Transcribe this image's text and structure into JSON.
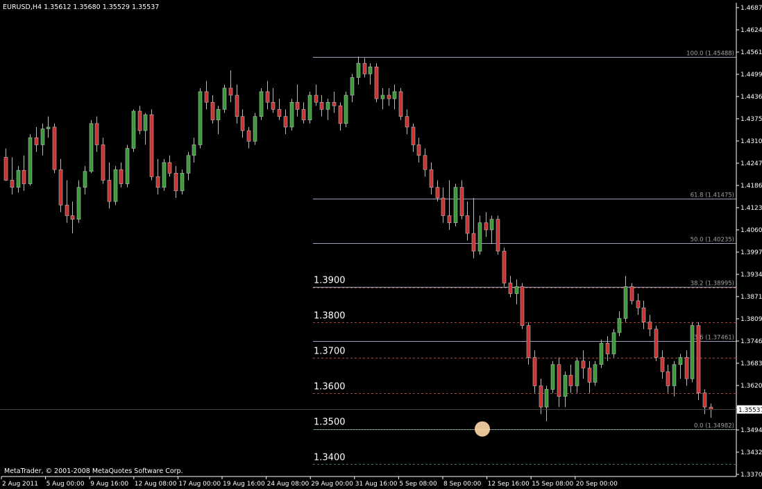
{
  "header": {
    "symbol_line": "EURUSD,H4  1.35612 1.35680 1.35529 1.35537"
  },
  "footer": {
    "copyright": "MetaTrader, © 2001-2008 MetaQuotes Software Corp."
  },
  "colors": {
    "background": "#000000",
    "axis": "#ffffff",
    "bull": "#3a9a3a",
    "bear": "#c83232",
    "wick": "#bbbbbb",
    "fib_line": "#9aa0b8",
    "round_line": "#c83232",
    "zero_line": "#4a8a4a",
    "bottom_line": "#3a7a3a",
    "circle_fill": "#ffd7a8",
    "price_tag": "#ffffff"
  },
  "chart_data": {
    "type": "candlestick",
    "symbol": "EURUSD",
    "timeframe": "H4",
    "last_price": 1.35537,
    "last_price_label": "1.35537",
    "ylim": [
      1.337,
      1.4687
    ],
    "y_ticks": [
      "1.46870",
      "1.46240",
      "1.45610",
      "1.44990",
      "1.44365",
      "1.43750",
      "1.43105",
      "1.42475",
      "1.41860",
      "1.41230",
      "1.40600",
      "1.39970",
      "1.39340",
      "1.38710",
      "1.38095",
      "1.37465",
      "1.36835",
      "1.36205",
      "1.35585",
      "1.34945",
      "1.34320",
      "1.33700"
    ],
    "x_ticks": [
      "2 Aug 2011",
      "5 Aug 00:00",
      "9 Aug 16:00",
      "12 Aug 08:00",
      "17 Aug 00:00",
      "19 Aug 16:00",
      "24 Aug 08:00",
      "29 Aug 00:00",
      "31 Aug 16:00",
      "5 Sep 08:00",
      "8 Sep 00:00",
      "12 Sep 16:00",
      "15 Sep 08:00",
      "20 Sep 00:00"
    ],
    "fibonacci": {
      "levels": [
        {
          "label": "100.0 (1.45488)",
          "price": 1.45488
        },
        {
          "label": "61.8 (1.41475)",
          "price": 1.41475
        },
        {
          "label": "50.0 (1.40235)",
          "price": 1.40235
        },
        {
          "label": "38.2 (1.38995)",
          "price": 1.38995
        },
        {
          "label": "23.6 (1.37461)",
          "price": 1.37461
        },
        {
          "label": "0.0 (1.34982)",
          "price": 1.34982
        }
      ]
    },
    "round_levels": [
      {
        "label": "1.3900",
        "price": 1.39
      },
      {
        "label": "1.3800",
        "price": 1.38
      },
      {
        "label": "1.3700",
        "price": 1.37
      },
      {
        "label": "1.3600",
        "price": 1.36
      },
      {
        "label": "1.3500",
        "price": 1.35
      },
      {
        "label": "1.3400",
        "price": 1.34
      }
    ],
    "candles": [
      [
        1.4265,
        1.429,
        1.4198,
        1.42
      ],
      [
        1.42,
        1.4265,
        1.416,
        1.418
      ],
      [
        1.418,
        1.424,
        1.4165,
        1.4228
      ],
      [
        1.4228,
        1.427,
        1.417,
        1.419
      ],
      [
        1.419,
        1.433,
        1.4185,
        1.432
      ],
      [
        1.432,
        1.435,
        1.428,
        1.43
      ],
      [
        1.43,
        1.436,
        1.427,
        1.4345
      ],
      [
        1.4345,
        1.438,
        1.432,
        1.435
      ],
      [
        1.435,
        1.436,
        1.422,
        1.423
      ],
      [
        1.423,
        1.426,
        1.411,
        1.413
      ],
      [
        1.413,
        1.42,
        1.408,
        1.41
      ],
      [
        1.41,
        1.414,
        1.405,
        1.409
      ],
      [
        1.409,
        1.42,
        1.408,
        1.418
      ],
      [
        1.418,
        1.424,
        1.416,
        1.4225
      ],
      [
        1.4225,
        1.437,
        1.422,
        1.436
      ],
      [
        1.436,
        1.438,
        1.428,
        1.43
      ],
      [
        1.43,
        1.432,
        1.419,
        1.42
      ],
      [
        1.42,
        1.425,
        1.412,
        1.414
      ],
      [
        1.414,
        1.424,
        1.413,
        1.423
      ],
      [
        1.423,
        1.425,
        1.418,
        1.419
      ],
      [
        1.419,
        1.43,
        1.418,
        1.429
      ],
      [
        1.429,
        1.44,
        1.428,
        1.4395
      ],
      [
        1.4395,
        1.441,
        1.433,
        1.434
      ],
      [
        1.434,
        1.439,
        1.43,
        1.4385
      ],
      [
        1.4385,
        1.44,
        1.42,
        1.421
      ],
      [
        1.421,
        1.426,
        1.416,
        1.418
      ],
      [
        1.418,
        1.426,
        1.417,
        1.425
      ],
      [
        1.425,
        1.427,
        1.421,
        1.422
      ],
      [
        1.422,
        1.424,
        1.415,
        1.417
      ],
      [
        1.417,
        1.423,
        1.416,
        1.422
      ],
      [
        1.422,
        1.428,
        1.42,
        1.427
      ],
      [
        1.427,
        1.432,
        1.425,
        1.43
      ],
      [
        1.43,
        1.446,
        1.429,
        1.445
      ],
      [
        1.445,
        1.448,
        1.44,
        1.442
      ],
      [
        1.442,
        1.444,
        1.436,
        1.437
      ],
      [
        1.437,
        1.441,
        1.433,
        1.44
      ],
      [
        1.44,
        1.447,
        1.439,
        1.446
      ],
      [
        1.446,
        1.451,
        1.442,
        1.444
      ],
      [
        1.444,
        1.447,
        1.436,
        1.438
      ],
      [
        1.438,
        1.44,
        1.432,
        1.434
      ],
      [
        1.434,
        1.435,
        1.429,
        1.431
      ],
      [
        1.431,
        1.439,
        1.43,
        1.438
      ],
      [
        1.438,
        1.446,
        1.437,
        1.445
      ],
      [
        1.445,
        1.448,
        1.44,
        1.442
      ],
      [
        1.442,
        1.446,
        1.439,
        1.44
      ],
      [
        1.44,
        1.443,
        1.437,
        1.438
      ],
      [
        1.438,
        1.44,
        1.433,
        1.435
      ],
      [
        1.435,
        1.443,
        1.434,
        1.442
      ],
      [
        1.442,
        1.447,
        1.438,
        1.44
      ],
      [
        1.44,
        1.442,
        1.436,
        1.437
      ],
      [
        1.437,
        1.445,
        1.436,
        1.444
      ],
      [
        1.444,
        1.447,
        1.441,
        1.442
      ],
      [
        1.442,
        1.444,
        1.438,
        1.44
      ],
      [
        1.44,
        1.443,
        1.437,
        1.442
      ],
      [
        1.442,
        1.445,
        1.439,
        1.441
      ],
      [
        1.441,
        1.442,
        1.434,
        1.436
      ],
      [
        1.436,
        1.445,
        1.435,
        1.444
      ],
      [
        1.444,
        1.45,
        1.442,
        1.449
      ],
      [
        1.449,
        1.4549,
        1.447,
        1.453
      ],
      [
        1.453,
        1.4545,
        1.449,
        1.45
      ],
      [
        1.45,
        1.453,
        1.447,
        1.452
      ],
      [
        1.452,
        1.453,
        1.442,
        1.443
      ],
      [
        1.443,
        1.446,
        1.44,
        1.444
      ],
      [
        1.444,
        1.446,
        1.441,
        1.443
      ],
      [
        1.443,
        1.447,
        1.44,
        1.445
      ],
      [
        1.445,
        1.446,
        1.437,
        1.438
      ],
      [
        1.438,
        1.44,
        1.433,
        1.435
      ],
      [
        1.435,
        1.436,
        1.428,
        1.43
      ],
      [
        1.43,
        1.432,
        1.425,
        1.427
      ],
      [
        1.427,
        1.429,
        1.421,
        1.423
      ],
      [
        1.423,
        1.425,
        1.416,
        1.418
      ],
      [
        1.418,
        1.42,
        1.414,
        1.415
      ],
      [
        1.415,
        1.418,
        1.408,
        1.41
      ],
      [
        1.41,
        1.42,
        1.406,
        1.408
      ],
      [
        1.408,
        1.419,
        1.407,
        1.418
      ],
      [
        1.418,
        1.42,
        1.409,
        1.41
      ],
      [
        1.41,
        1.414,
        1.403,
        1.405
      ],
      [
        1.405,
        1.415,
        1.398,
        1.4
      ],
      [
        1.4,
        1.41,
        1.399,
        1.408
      ],
      [
        1.408,
        1.411,
        1.404,
        1.406
      ],
      [
        1.406,
        1.41,
        1.402,
        1.409
      ],
      [
        1.409,
        1.41,
        1.399,
        1.4
      ],
      [
        1.4,
        1.401,
        1.39,
        1.391
      ],
      [
        1.391,
        1.393,
        1.387,
        1.388
      ],
      [
        1.388,
        1.392,
        1.385,
        1.39
      ],
      [
        1.39,
        1.391,
        1.378,
        1.379
      ],
      [
        1.379,
        1.38,
        1.368,
        1.37
      ],
      [
        1.37,
        1.372,
        1.36,
        1.362
      ],
      [
        1.362,
        1.364,
        1.354,
        1.356
      ],
      [
        1.356,
        1.362,
        1.352,
        1.361
      ],
      [
        1.361,
        1.369,
        1.36,
        1.368
      ],
      [
        1.368,
        1.37,
        1.356,
        1.359
      ],
      [
        1.359,
        1.366,
        1.356,
        1.365
      ],
      [
        1.365,
        1.368,
        1.36,
        1.362
      ],
      [
        1.362,
        1.37,
        1.36,
        1.369
      ],
      [
        1.369,
        1.372,
        1.364,
        1.367
      ],
      [
        1.367,
        1.369,
        1.36,
        1.363
      ],
      [
        1.363,
        1.369,
        1.362,
        1.368
      ],
      [
        1.368,
        1.375,
        1.367,
        1.374
      ],
      [
        1.374,
        1.376,
        1.369,
        1.371
      ],
      [
        1.371,
        1.378,
        1.37,
        1.377
      ],
      [
        1.377,
        1.383,
        1.376,
        1.381
      ],
      [
        1.381,
        1.393,
        1.38,
        1.39
      ],
      [
        1.39,
        1.391,
        1.385,
        1.386
      ],
      [
        1.386,
        1.388,
        1.382,
        1.384
      ],
      [
        1.384,
        1.386,
        1.378,
        1.38
      ],
      [
        1.38,
        1.382,
        1.376,
        1.378
      ],
      [
        1.378,
        1.379,
        1.369,
        1.37
      ],
      [
        1.37,
        1.372,
        1.364,
        1.366
      ],
      [
        1.366,
        1.368,
        1.36,
        1.362
      ],
      [
        1.362,
        1.369,
        1.359,
        1.368
      ],
      [
        1.368,
        1.371,
        1.364,
        1.37
      ],
      [
        1.37,
        1.372,
        1.362,
        1.364
      ],
      [
        1.364,
        1.38,
        1.363,
        1.379
      ],
      [
        1.379,
        1.38,
        1.358,
        1.36
      ],
      [
        1.36,
        1.361,
        1.354,
        1.356
      ],
      [
        1.356,
        1.357,
        1.353,
        1.3554
      ]
    ]
  }
}
